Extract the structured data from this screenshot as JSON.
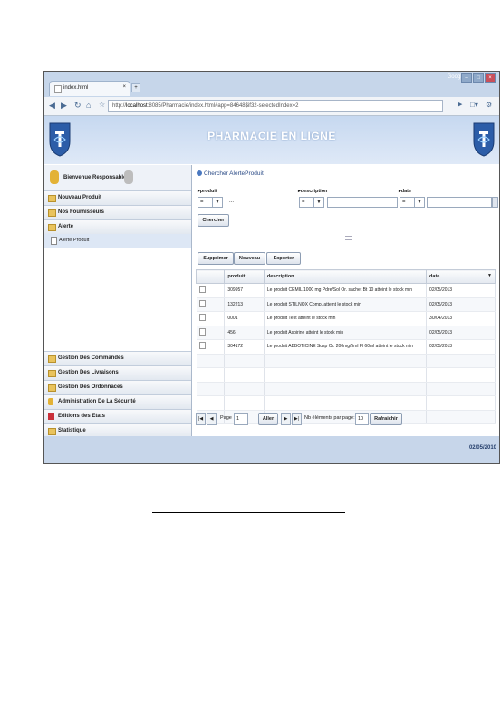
{
  "browser": {
    "google_label": "Google",
    "tab_title": "index.html",
    "tab_close": "×",
    "new_tab": "+",
    "url_prefix": "http://",
    "url_host": "localhost",
    "url_rest": ":8085/Pharmacie/index.html#app=84648$if32-selectedIndex=2",
    "win_min": "–",
    "win_max": "□",
    "win_close": "×"
  },
  "header": {
    "title": "PHARMACIE EN LIGNE"
  },
  "sidebar": {
    "welcome": "Bienvenue Responsable",
    "items_top": [
      {
        "label": "Nouveau Produit"
      },
      {
        "label": "Nos Fournisseurs"
      },
      {
        "label": "Alerte"
      }
    ],
    "sub_item": "Alerte Produit",
    "items_bottom": [
      {
        "label": "Gestion Des Commandes"
      },
      {
        "label": "Gestion Des Livraisons"
      },
      {
        "label": "Gestion Des Ordonnaces"
      },
      {
        "label": "Administration De La Sécurité"
      },
      {
        "label": "Editions des Etats"
      },
      {
        "label": "Statistique"
      }
    ]
  },
  "main": {
    "section_title": "Chercher AlerteProduit",
    "filters": {
      "produit_label": "produit",
      "description_label": "description",
      "date_label": "date",
      "op_value": "=",
      "produit_extra": "..."
    },
    "buttons": {
      "search": "Chercher",
      "delete": "Supprimer",
      "new": "Nouveau",
      "export": "Exporter"
    },
    "table": {
      "columns": [
        "produit",
        "description",
        "date"
      ],
      "rows": [
        {
          "produit": "309957",
          "description": "Le produit CEMIL 1000 mg Pdre/Sol Or. sachet Bt 10 atteint le stock min",
          "date": "02/05/2013"
        },
        {
          "produit": "132213",
          "description": "Le produit STILNOX Comp. atteint le stock min",
          "date": "02/05/2013"
        },
        {
          "produit": "0001",
          "description": "Le produit Test atteint le stock min",
          "date": "30/04/2013"
        },
        {
          "produit": "456",
          "description": "Le produit Aspirine atteint le stock min",
          "date": "02/05/2013"
        },
        {
          "produit": "304172",
          "description": "Le produit ABBOTICINE Susp Or. 200mg/5ml Fl 60ml atteint le stock min",
          "date": "02/05/2013"
        }
      ]
    },
    "pager": {
      "page_label": "Page",
      "page_value": "1",
      "go_button": "Aller",
      "per_page_label": "Nb éléments par page:",
      "per_page_value": "10",
      "refresh_button": "Rafraichir"
    }
  },
  "status": {
    "date": "02/05/2010"
  }
}
